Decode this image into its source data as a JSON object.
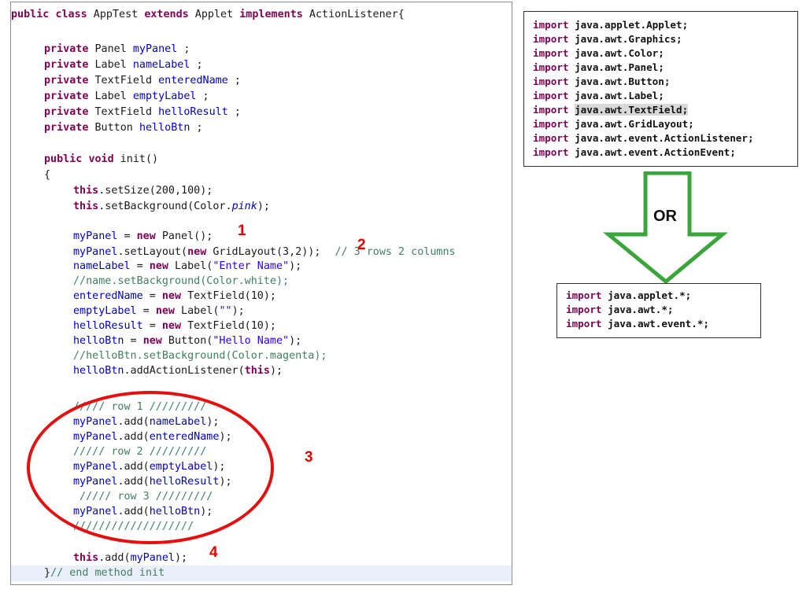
{
  "code": {
    "class_decl": {
      "kw1": "public",
      "kw2": "class",
      "name": " AppTest",
      "kw3": "extends",
      "parent": " Applet ",
      "kw4": "implements",
      "iface": " ActionListener{"
    },
    "fields": [
      {
        "kw": "private",
        "type": " Panel ",
        "name": "myPanel",
        "end": " ;"
      },
      {
        "kw": "private",
        "type": " Label ",
        "name": "nameLabel",
        "end": " ;"
      },
      {
        "kw": "private",
        "type": " TextField ",
        "name": "enteredName",
        "end": " ;"
      },
      {
        "kw": "private",
        "type": " Label ",
        "name": "emptyLabel",
        "end": " ;"
      },
      {
        "kw": "private",
        "type": " TextField ",
        "name": "helloResult",
        "end": " ;"
      },
      {
        "kw": "private",
        "type": " Button ",
        "name": "helloBtn",
        "end": " ;"
      }
    ],
    "init_decl": {
      "kw1": "public",
      "kw2": "void",
      "rest": " init()"
    },
    "open_brace": "{",
    "set_size": {
      "kw": "this",
      "rest": ".setSize(200,100);"
    },
    "set_bg": {
      "kw": "this",
      "rest": ".setBackground(Color.",
      "it": "pink",
      "end": ");"
    },
    "l_panel": {
      "f": "myPanel",
      "a": " = ",
      "kw": "new",
      "b": " Panel();"
    },
    "l_layout": {
      "f": "myPanel",
      "a": ".setLayout(",
      "kw": "new",
      "b": " GridLayout(3,2));",
      "c": "// 3 rows 2 columns"
    },
    "l_name": {
      "f": "nameLabel",
      "a": " = ",
      "kw": "new",
      "b": " Label(",
      "s": "\"Enter Name\"",
      "c": ");"
    },
    "l_cmt1": "//name.setBackground(Color.white);",
    "l_entered": {
      "f": "enteredName",
      "a": " = ",
      "kw": "new",
      "b": " TextField(10);"
    },
    "l_empty": {
      "f": "emptyLabel",
      "a": " = ",
      "kw": "new",
      "b": " Label(",
      "s": "\"\"",
      "c": ");"
    },
    "l_result": {
      "f": "helloResult",
      "a": " = ",
      "kw": "new",
      "b": " TextField(10);"
    },
    "l_btn": {
      "f": "helloBtn",
      "a": " = ",
      "kw": "new",
      "b": " Button(",
      "s": "\"Hello Name\"",
      "c": ");"
    },
    "l_cmt2": "//helloBtn.setBackground(Color.magenta);",
    "l_listener": {
      "f": "helloBtn",
      "a": ".addActionListener(",
      "kw": "this",
      "b": ");"
    },
    "row1": "///// row 1 /////////",
    "add1": {
      "f": "myPanel",
      "a": ".add(",
      "g": "nameLabel",
      "b": ");"
    },
    "add2": {
      "f": "myPanel",
      "a": ".add(",
      "g": "enteredName",
      "b": ");"
    },
    "row2": "///// row 2 /////////",
    "add3": {
      "f": "myPanel",
      "a": ".add(",
      "g": "emptyLabel",
      "b": ");"
    },
    "add4": {
      "f": "myPanel",
      "a": ".add(",
      "g": "helloResult",
      "b": ");"
    },
    "row3": " ///// row 3 /////////",
    "add5": {
      "f": "myPanel",
      "a": ".add(",
      "g": "helloBtn",
      "b": ");"
    },
    "slashes": "///////////////////",
    "this_add": {
      "kw": "this",
      "a": ".add(",
      "g": "myPanel",
      "b": ");"
    },
    "end": {
      "a": "}",
      "c": "// end method init"
    }
  },
  "annotations": {
    "n1": "1",
    "n2": "2",
    "n3": "3",
    "n4": "4"
  },
  "imports_full": [
    {
      "kw": "import",
      "path": "java.applet.Applet;"
    },
    {
      "kw": "import",
      "path": "java.awt.Graphics;"
    },
    {
      "kw": "import",
      "path": "java.awt.Color;"
    },
    {
      "kw": "import",
      "path": "java.awt.Panel;"
    },
    {
      "kw": "import",
      "path": "java.awt.Button;"
    },
    {
      "kw": "import",
      "path": "java.awt.Label;"
    },
    {
      "kw": "import",
      "path": "java.awt.TextField;"
    },
    {
      "kw": "import",
      "path": "java.awt.GridLayout;"
    },
    {
      "kw": "import",
      "path": "java.awt.event.ActionListener;"
    },
    {
      "kw": "import",
      "path": "java.awt.event.ActionEvent;"
    }
  ],
  "or_label": "OR",
  "imports_short": [
    {
      "kw": "import",
      "path": "java.applet.*;"
    },
    {
      "kw": "import",
      "path": "java.awt.*;"
    },
    {
      "kw": "import",
      "path": "java.awt.event.*;"
    }
  ],
  "colors": {
    "keyword": "#7f0055",
    "field": "#0000c0",
    "string": "#2a00ff",
    "comment": "#3f7f5f",
    "annotation": "#e30000",
    "arrow": "#3aa53a"
  }
}
